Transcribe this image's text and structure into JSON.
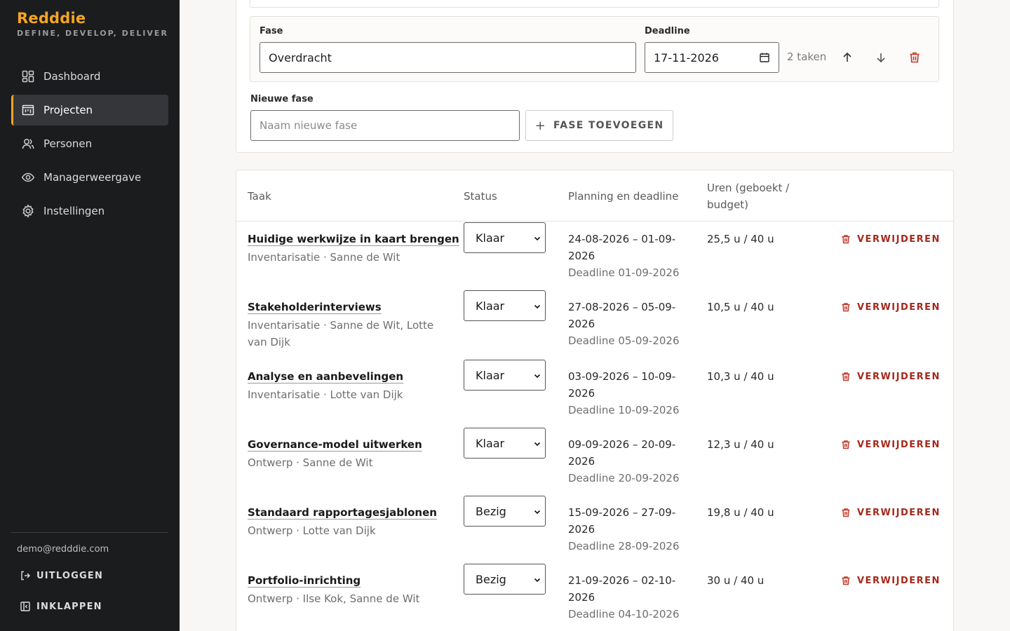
{
  "brand": {
    "name": "Redddie",
    "tagline": "DEFINE, DEVELOP, DELIVER"
  },
  "nav": [
    {
      "label": "Dashboard",
      "icon": "dashboard-icon",
      "active": false
    },
    {
      "label": "Projecten",
      "icon": "projects-icon",
      "active": true
    },
    {
      "label": "Personen",
      "icon": "people-icon",
      "active": false
    },
    {
      "label": "Managerweergave",
      "icon": "eye-icon",
      "active": false
    },
    {
      "label": "Instellingen",
      "icon": "gear-icon",
      "active": false
    }
  ],
  "user": {
    "email": "demo@redddie.com",
    "logout_label": "UITLOGGEN",
    "collapse_label": "INKLAPPEN"
  },
  "phase": {
    "fase_label": "Fase",
    "fase_value": "Overdracht",
    "deadline_label": "Deadline",
    "deadline_value": "17-11-2026",
    "task_count": "2 taken"
  },
  "new_phase": {
    "label": "Nieuwe fase",
    "placeholder": "Naam nieuwe fase",
    "add_label": "FASE TOEVOEGEN"
  },
  "table": {
    "headers": {
      "task": "Taak",
      "status": "Status",
      "planning": "Planning en deadline",
      "hours_l1": "Uren (geboekt /",
      "hours_l2": "budget)"
    },
    "delete_label": "VERWIJDEREN",
    "rows": [
      {
        "title": "Huidige werkwijze in kaart brengen",
        "meta": "Inventarisatie · Sanne de Wit",
        "status": "Klaar",
        "plan_l1": "24-08-2026 – 01-09-",
        "plan_l2": "2026",
        "deadline": "Deadline 01-09-2026",
        "hours": "25,5 u / 40 u"
      },
      {
        "title": "Stakeholderinterviews",
        "meta": "Inventarisatie · Sanne de Wit, Lotte van Dijk",
        "status": "Klaar",
        "plan_l1": "27-08-2026 – 05-09-",
        "plan_l2": "2026",
        "deadline": "Deadline 05-09-2026",
        "hours": "10,5 u / 40 u"
      },
      {
        "title": "Analyse en aanbevelingen",
        "meta": "Inventarisatie · Lotte van Dijk",
        "status": "Klaar",
        "plan_l1": "03-09-2026 – 10-09-",
        "plan_l2": "2026",
        "deadline": "Deadline 10-09-2026",
        "hours": "10,3 u / 40 u"
      },
      {
        "title": "Governance-model uitwerken",
        "meta": "Ontwerp · Sanne de Wit",
        "status": "Klaar",
        "plan_l1": "09-09-2026 – 20-09-",
        "plan_l2": "2026",
        "deadline": "Deadline 20-09-2026",
        "hours": "12,3 u / 40 u"
      },
      {
        "title": "Standaard rapportagesjablonen",
        "meta": "Ontwerp · Lotte van Dijk",
        "status": "Bezig",
        "plan_l1": "15-09-2026 – 27-09-",
        "plan_l2": "2026",
        "deadline": "Deadline 28-09-2026",
        "hours": "19,8 u / 40 u"
      },
      {
        "title": "Portfolio-inrichting",
        "meta": "Ontwerp · Ilse Kok, Sanne de Wit",
        "status": "Bezig",
        "plan_l1": "21-09-2026 – 02-10-",
        "plan_l2": "2026",
        "deadline": "Deadline 04-10-2026",
        "hours": "30 u / 40 u"
      }
    ]
  },
  "colors": {
    "accent": "#f5a524",
    "danger": "#a3291c",
    "sidebar_bg": "#1b1c1e"
  }
}
